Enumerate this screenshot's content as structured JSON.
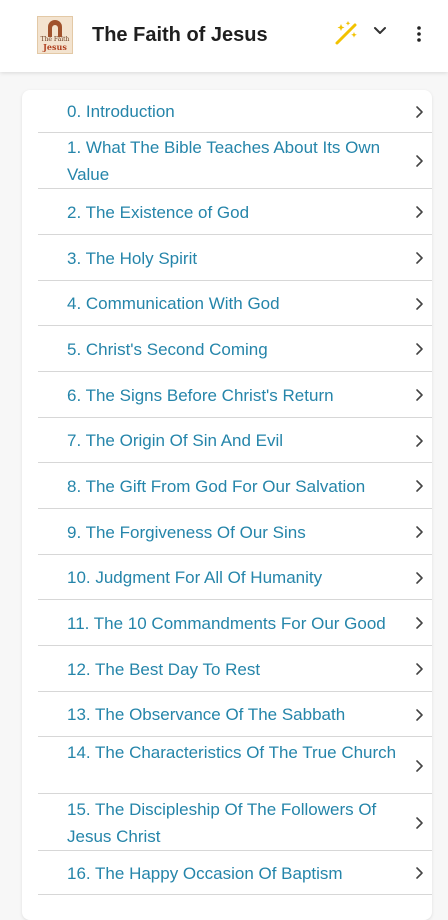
{
  "app": {
    "title": "The Faith of Jesus",
    "logo_text_top": "The Faith",
    "logo_text_bottom": "Jesus"
  },
  "toolbar": {
    "icons": [
      "magic-wand-icon",
      "chevron-down-icon",
      "more-vertical-icon"
    ]
  },
  "colors": {
    "link": "#2585aa",
    "wand": "#f2c200"
  },
  "chapters": [
    "0. Introduction",
    "1. What The Bible Teaches About Its Own Value",
    "2. The Existence of God",
    "3. The Holy Spirit",
    "4. Communication With God",
    "5. Christ's Second Coming",
    "6. The Signs Before Christ's Return",
    "7. The Origin Of Sin And Evil",
    "8. The Gift From God For Our Salvation",
    "9. The Forgiveness Of Our Sins",
    "10. Judgment For All Of Humanity",
    "11. The 10 Commandments For Our Good",
    "12. The Best Day To Rest",
    "13. The Observance Of The Sabbath",
    "14. The Characteristics Of The True Church",
    "15. The Discipleship Of The Followers Of Jesus Christ",
    "16. The Happy Occasion Of Baptism"
  ]
}
